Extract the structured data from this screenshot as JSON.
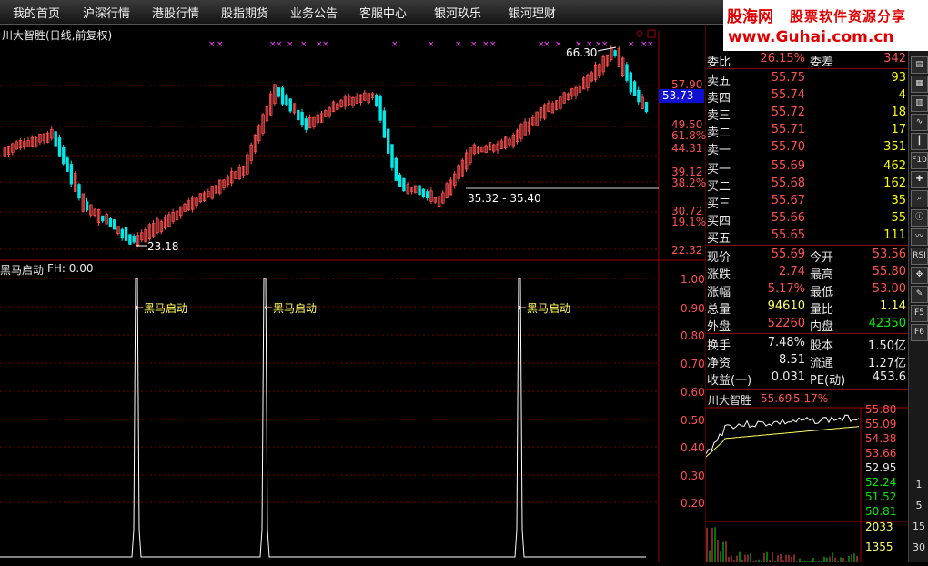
{
  "menu": [
    "我的首页",
    "沪深行情",
    "港股行情",
    "股指期货",
    "业务公告",
    "客服中心",
    "银河玖乐",
    "银河理财"
  ],
  "logo": {
    "line1a": "股海网",
    "line1b": "股票软件资源分享",
    "line2": "www.Guhai.com.cn"
  },
  "main_chart": {
    "title": "川大智胜(日线,前复权)",
    "y_labels": [
      "57.90",
      "49.50",
      "44.31",
      "39.12",
      "30.72",
      "22.32"
    ],
    "pct_labels": [
      "61.8%",
      "38.2%",
      "19.1%"
    ],
    "current_price_tag": "53.73",
    "annotations": {
      "high": "66.30",
      "low": "23.18",
      "range": "35.32 - 35.40"
    },
    "colors": {
      "up": "#ff5050",
      "down": "#00e8e8",
      "grid": "#7a0000",
      "marker": "#ff40ff"
    }
  },
  "indicator": {
    "title": "黑马启动",
    "fh_label": "FH: 0.00",
    "signal_label": "黑马启动",
    "y_labels": [
      "1.00",
      "0.90",
      "0.80",
      "0.70",
      "0.60",
      "0.50",
      "0.40",
      "0.30",
      "0.20"
    ]
  },
  "quote": {
    "rows": [
      {
        "a": "委比",
        "av": "26.15%",
        "b": "委差",
        "bv": "342",
        "avc": "#ff5050",
        "bvc": "#ff5050"
      },
      {
        "a": "卖五",
        "av": "55.75",
        "b": "",
        "bv": "93",
        "avc": "#ff5050",
        "bvc": "#ffff00"
      },
      {
        "a": "卖四",
        "av": "55.74",
        "b": "",
        "bv": "4",
        "avc": "#ff5050",
        "bvc": "#ffff00"
      },
      {
        "a": "卖三",
        "av": "55.72",
        "b": "",
        "bv": "18",
        "avc": "#ff5050",
        "bvc": "#ffff00"
      },
      {
        "a": "卖二",
        "av": "55.71",
        "b": "",
        "bv": "17",
        "avc": "#ff5050",
        "bvc": "#ffff00"
      },
      {
        "a": "卖一",
        "av": "55.70",
        "b": "",
        "bv": "351",
        "avc": "#ff5050",
        "bvc": "#ffff00"
      },
      {
        "a": "买一",
        "av": "55.69",
        "b": "",
        "bv": "462",
        "avc": "#ff5050",
        "bvc": "#ffff00"
      },
      {
        "a": "买二",
        "av": "55.68",
        "b": "",
        "bv": "162",
        "avc": "#ff5050",
        "bvc": "#ffff00"
      },
      {
        "a": "买三",
        "av": "55.67",
        "b": "",
        "bv": "35",
        "avc": "#ff5050",
        "bvc": "#ffff00"
      },
      {
        "a": "买四",
        "av": "55.66",
        "b": "",
        "bv": "55",
        "avc": "#ff5050",
        "bvc": "#ffff00"
      },
      {
        "a": "买五",
        "av": "55.65",
        "b": "",
        "bv": "111",
        "avc": "#ff5050",
        "bvc": "#ffff00"
      },
      {
        "a": "现价",
        "av": "55.69",
        "b": "今开",
        "bv": "53.56",
        "avc": "#ff5050",
        "bvc": "#ff5050"
      },
      {
        "a": "涨跌",
        "av": "2.74",
        "b": "最高",
        "bv": "55.80",
        "avc": "#ff5050",
        "bvc": "#ff5050"
      },
      {
        "a": "涨幅",
        "av": "5.17%",
        "b": "最低",
        "bv": "53.00",
        "avc": "#ff5050",
        "bvc": "#ff5050"
      },
      {
        "a": "总量",
        "av": "94610",
        "b": "量比",
        "bv": "1.14",
        "avc": "#ffff66",
        "bvc": "#ffff66"
      },
      {
        "a": "外盘",
        "av": "52260",
        "b": "内盘",
        "bv": "42350",
        "avc": "#ff5050",
        "bvc": "#00ee00"
      },
      {
        "a": "换手",
        "av": "7.48%",
        "b": "股本",
        "bv": "1.50亿",
        "avc": "#e8e8e8",
        "bvc": "#e8e8e8"
      },
      {
        "a": "净资",
        "av": "8.51",
        "b": "流通",
        "bv": "1.27亿",
        "avc": "#e8e8e8",
        "bvc": "#e8e8e8"
      },
      {
        "a": "收益(一)",
        "av": "0.031",
        "b": "PE(动)",
        "bv": "453.6",
        "avc": "#e8e8e8",
        "bvc": "#e8e8e8"
      }
    ]
  },
  "mini_chart": {
    "title": "川大智胜",
    "price": "55.69",
    "pct": "5.17%",
    "y_labels": [
      "55.80",
      "55.09",
      "54.38",
      "53.66",
      "52.95",
      "52.24",
      "51.52",
      "50.81"
    ],
    "vol_labels": [
      "2033",
      "1355"
    ]
  },
  "toolbar": {
    "icons": [
      "chart-icon",
      "table-icon",
      "grid-icon",
      "line-chart-icon",
      "candle-icon",
      "f10-icon",
      "cross-icon",
      "search-icon",
      "info-icon",
      "trend-icon",
      "rsi-icon",
      "move-icon",
      "pen-icon",
      "f5-icon",
      "f6-icon"
    ],
    "labels": [
      "",
      "",
      "",
      "",
      "",
      "F10",
      "",
      "",
      "",
      "",
      "RSI",
      "",
      "",
      "F5",
      "F6"
    ],
    "numbers": [
      "1",
      "5",
      "15",
      "30"
    ]
  }
}
